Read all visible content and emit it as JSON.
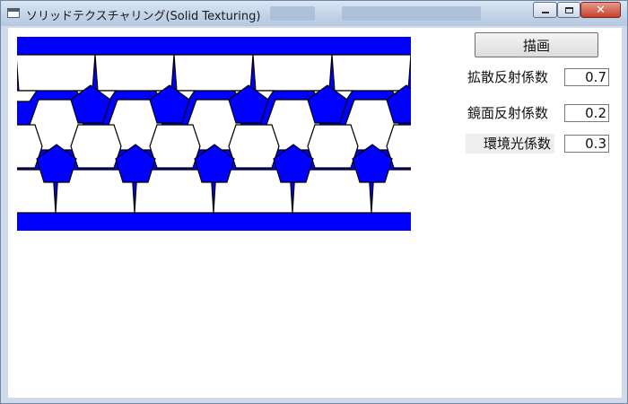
{
  "window": {
    "title": "ソリッドテクスチャリング(Solid Texturing)",
    "controls": {
      "minimize": "–",
      "maximize": "□",
      "close": "✕"
    }
  },
  "toolbar": {
    "draw_label": "描画"
  },
  "params": [
    {
      "label": "拡散反射係数",
      "value": "0.7"
    },
    {
      "label": "鏡面反射係数",
      "value": "0.2"
    },
    {
      "label": "環境光係数",
      "value": "0.3"
    }
  ],
  "render": {
    "pattern_color": "#0000ff",
    "background_color": "#ffffff",
    "line_color": "#000000"
  },
  "colors": {
    "titlebar": "#c5d5e8",
    "window_frame": "#cfdbea",
    "close_button": "#c4402a"
  }
}
